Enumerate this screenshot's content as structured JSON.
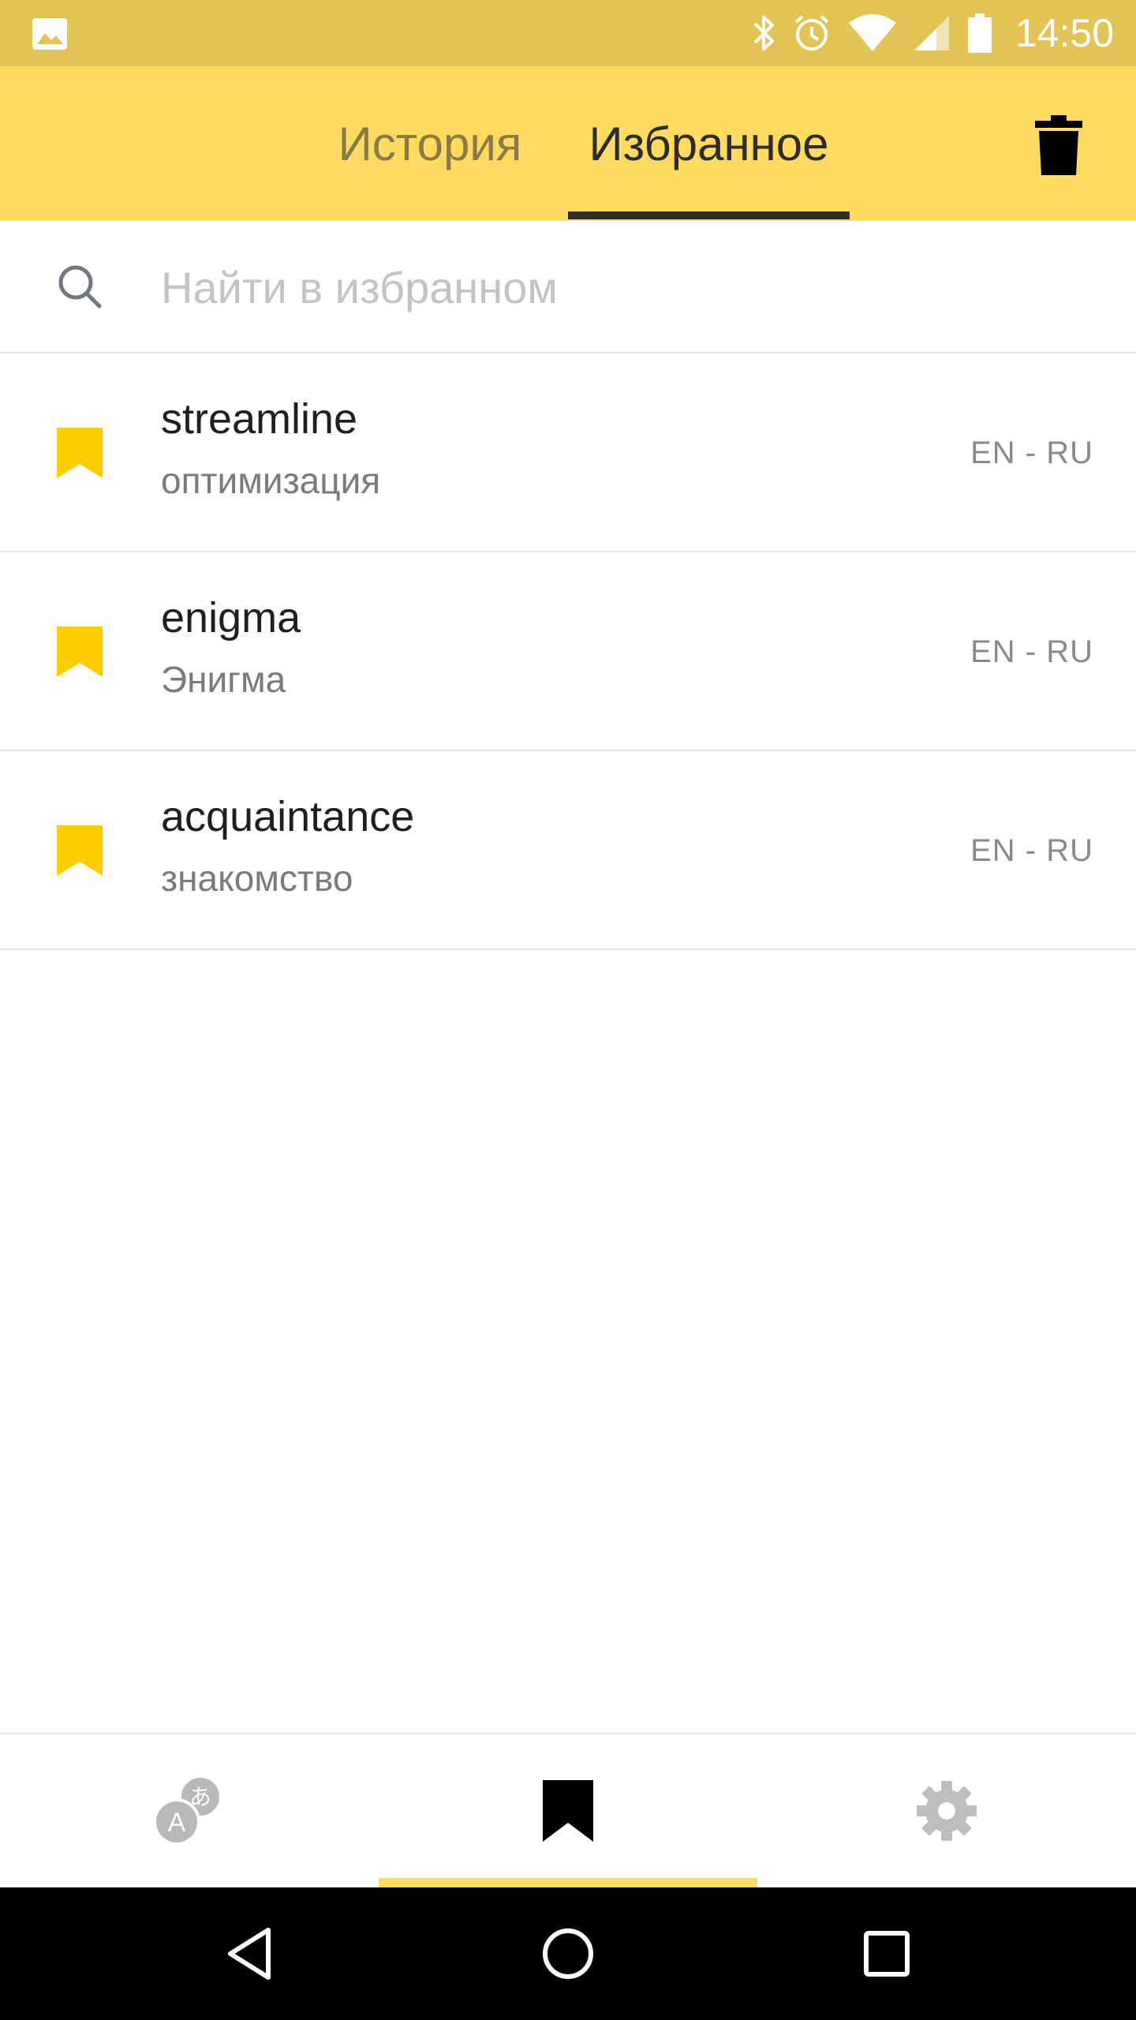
{
  "status_bar": {
    "time": "14:50",
    "icons": [
      "image-icon",
      "bluetooth-icon",
      "alarm-icon",
      "wifi-icon",
      "signal-icon",
      "battery-icon"
    ]
  },
  "header": {
    "tabs": [
      {
        "label": "История",
        "active": false
      },
      {
        "label": "Избранное",
        "active": true
      }
    ],
    "actions": [
      "trash-icon"
    ]
  },
  "search": {
    "placeholder": "Найти в избранном",
    "value": ""
  },
  "favorites": [
    {
      "word": "streamline",
      "translation": "оптимизация",
      "lang": "EN - RU"
    },
    {
      "word": "enigma",
      "translation": "Энигма",
      "lang": "EN - RU"
    },
    {
      "word": "acquaintance",
      "translation": "знакомство",
      "lang": "EN - RU"
    }
  ],
  "bottom_nav": {
    "items": [
      "translate-icon",
      "bookmark-icon",
      "settings-icon"
    ],
    "active_index": 1
  },
  "system_nav": {
    "items": [
      "back-icon",
      "home-icon",
      "recents-icon"
    ]
  },
  "colors": {
    "status_bar": "#E2C455",
    "header": "#FFDC60",
    "bookmark": "#FFCC00",
    "active_tab_underline": "#2e2e2e"
  }
}
